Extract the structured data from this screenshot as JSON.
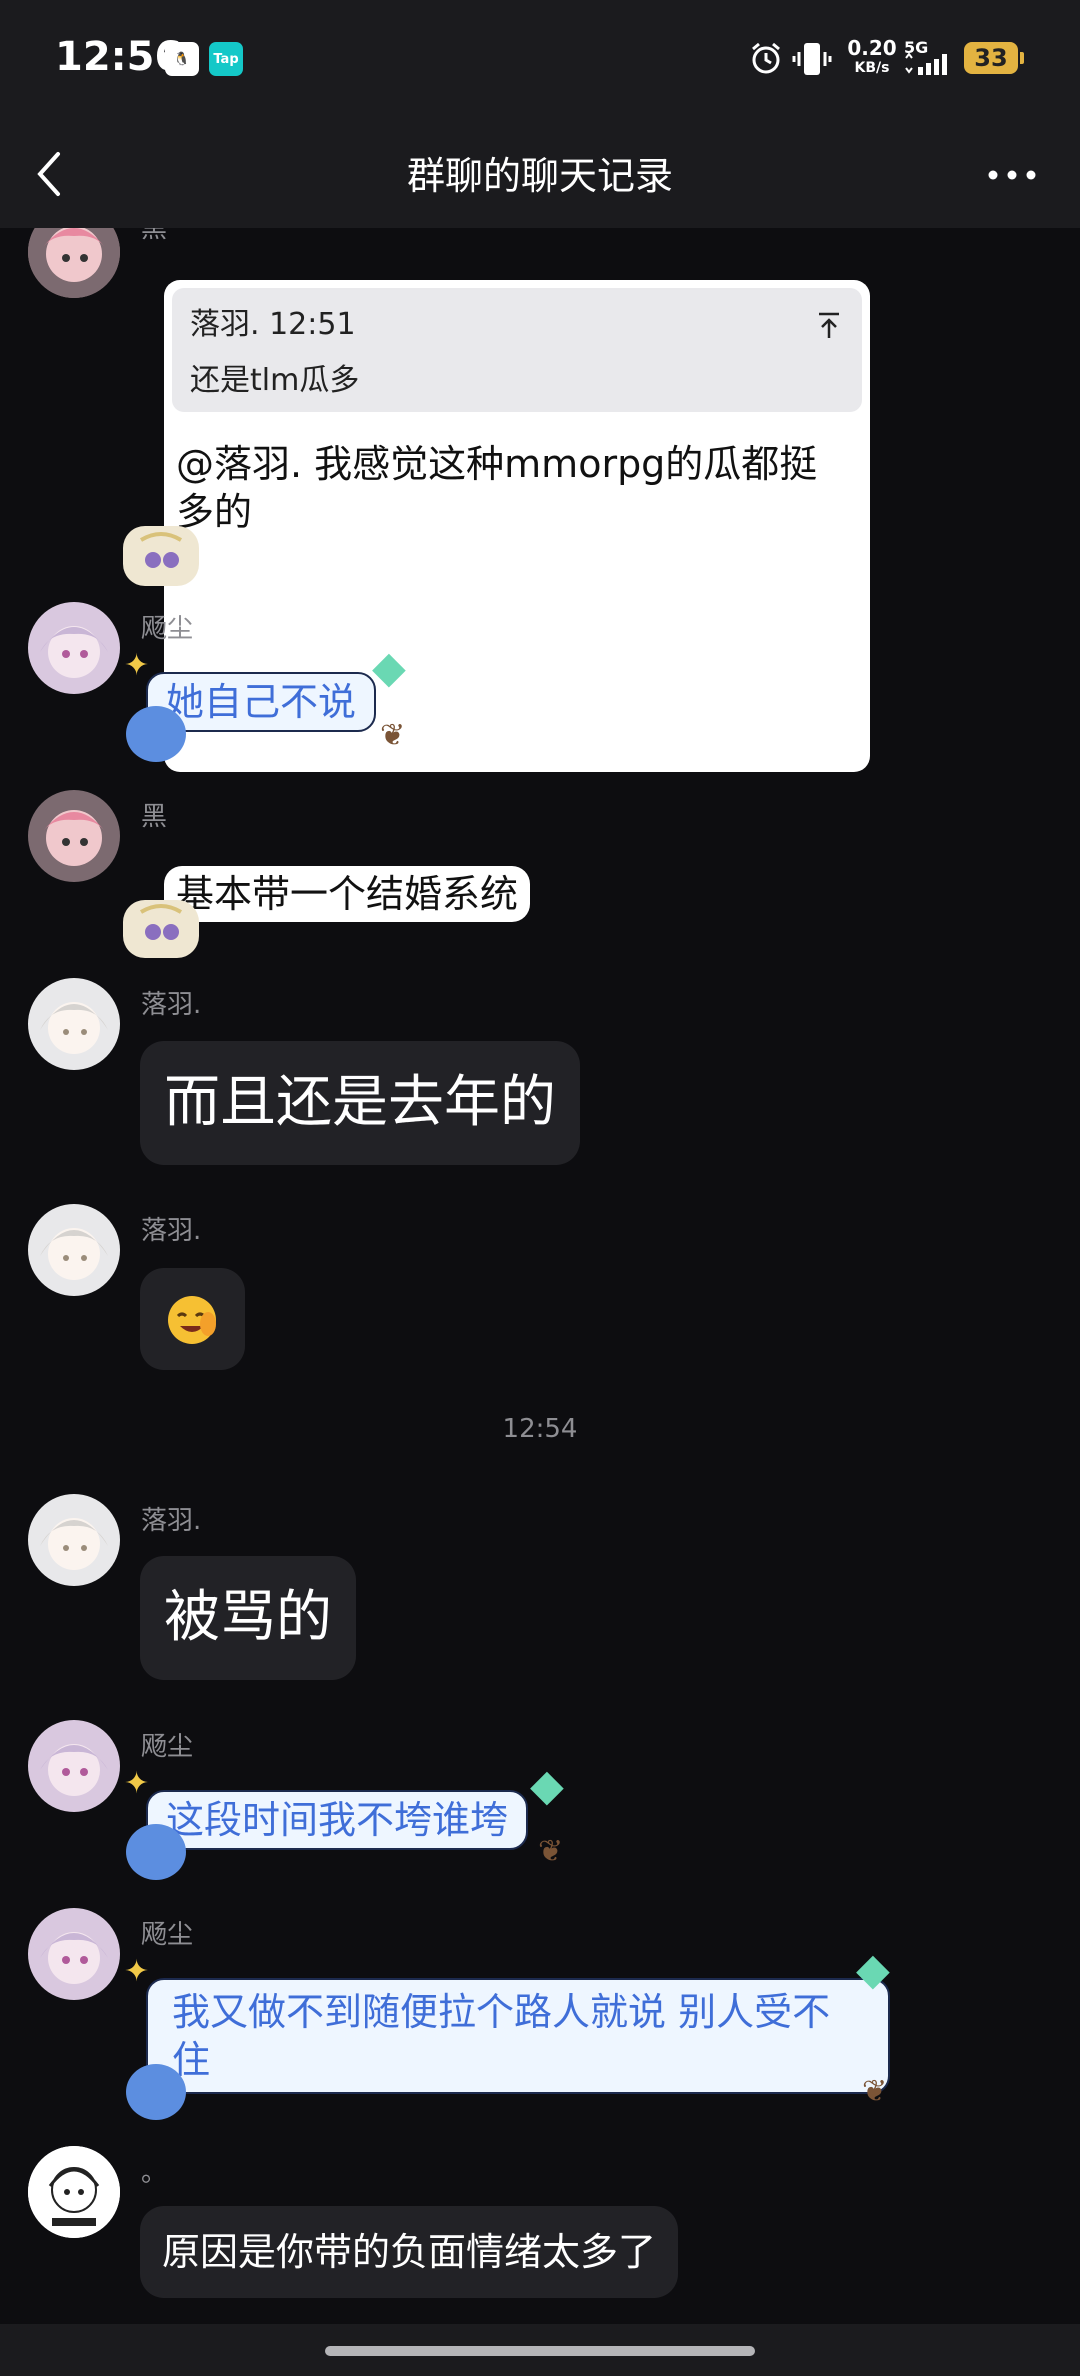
{
  "status_bar": {
    "time": "12:56",
    "net_speed": "0.20",
    "net_unit": "KB/s",
    "net_type": "5G",
    "battery": "33",
    "tap_label": "Tap"
  },
  "header": {
    "title": "群聊的聊天记录"
  },
  "messages": {
    "m1": {
      "name": "黑",
      "quote_meta": "落羽. 12:51",
      "quote_text": "还是tlm瓜多",
      "text": "@落羽. 我感觉这种mmorpg的瓜都挺多的"
    },
    "m2": {
      "name": "飏尘",
      "text": "她自己不说"
    },
    "m3": {
      "name": "黑",
      "text": "基本带一个结婚系统"
    },
    "m4": {
      "name": "落羽.",
      "text": "而且还是去年的"
    },
    "m5": {
      "name": "落羽."
    },
    "divider": "12:54",
    "m6": {
      "name": "落羽.",
      "text": "被骂的"
    },
    "m7": {
      "name": "飏尘",
      "text": "这段时间我不垮谁垮"
    },
    "m8": {
      "name": "飏尘",
      "text": "我又做不到随便拉个路人就说  别人受不住"
    },
    "m9": {
      "name": "。",
      "text": "原因是你带的负面情绪太多了"
    }
  },
  "theme": {
    "background": "#0d0d10",
    "bar": "#1b1b1e",
    "dark_bubble": "#222226",
    "blue_text": "#3f6ed8"
  }
}
